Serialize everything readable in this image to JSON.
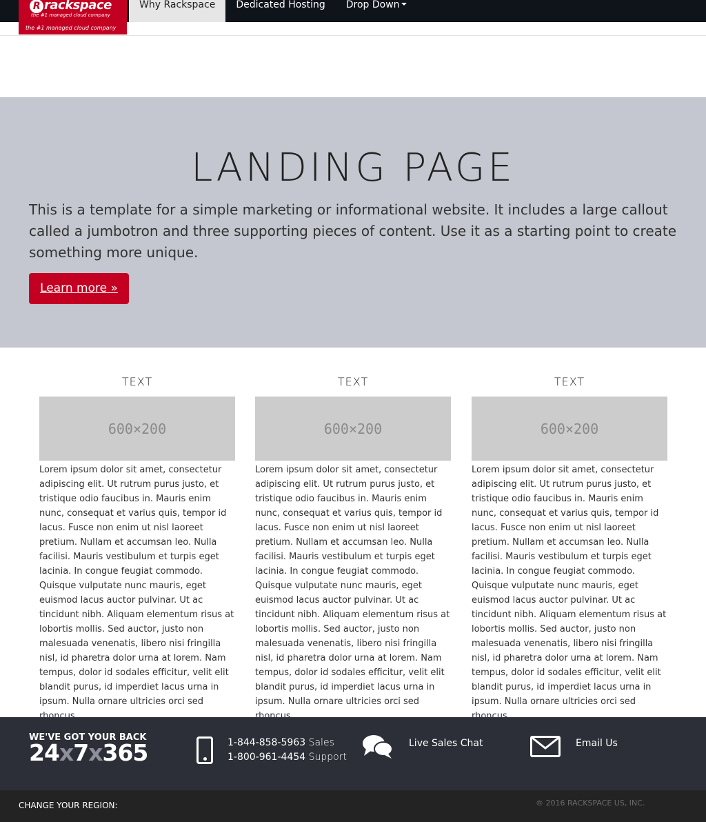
{
  "brand": {
    "name": "rackspace",
    "initial": "R",
    "tagline": "the #1 managed cloud company",
    "accent_color": "#c40022"
  },
  "nav": {
    "items": [
      {
        "label": "Why Rackspace",
        "active": true
      },
      {
        "label": "Dedicated Hosting",
        "active": false
      },
      {
        "label": "Drop Down",
        "active": false,
        "dropdown": true
      }
    ]
  },
  "jumbotron": {
    "title": "LANDING PAGE",
    "text": "This is a template for a simple marketing or informational website. It includes a large callout called a jumbotron and three supporting pieces of content. Use it as a starting point to create something more unique.",
    "button_label": "Learn more »"
  },
  "columns": [
    {
      "heading": "TEXT",
      "placeholder": "600×200",
      "body": "Lorem ipsum dolor sit amet, consectetur adipiscing elit. Ut rutrum purus justo, et tristique odio faucibus in. Mauris enim nunc, consequat et varius quis, tempor id lacus. Fusce non enim ut nisl laoreet pretium. Nullam et accumsan leo. Nulla facilisi. Mauris vestibulum et turpis eget lacinia. In congue feugiat commodo. Quisque vulputate nunc mauris, eget euismod lacus auctor pulvinar. Ut ac tincidunt nibh. Aliquam elementum risus at lobortis mollis. Sed auctor, justo non malesuada venenatis, libero nisi fringilla nisl, id pharetra dolor urna at lorem. Nam tempus, dolor id sodales efficitur, velit elit blandit purus, id imperdiet lacus urna in ipsum. Nulla ornare ultricies orci sed rhoncus."
    },
    {
      "heading": "TEXT",
      "placeholder": "600×200",
      "body": "Lorem ipsum dolor sit amet, consectetur adipiscing elit. Ut rutrum purus justo, et tristique odio faucibus in. Mauris enim nunc, consequat et varius quis, tempor id lacus. Fusce non enim ut nisl laoreet pretium. Nullam et accumsan leo. Nulla facilisi. Mauris vestibulum et turpis eget lacinia. In congue feugiat commodo. Quisque vulputate nunc mauris, eget euismod lacus auctor pulvinar. Ut ac tincidunt nibh. Aliquam elementum risus at lobortis mollis. Sed auctor, justo non malesuada venenatis, libero nisi fringilla nisl, id pharetra dolor urna at lorem. Nam tempus, dolor id sodales efficitur, velit elit blandit purus, id imperdiet lacus urna in ipsum. Nulla ornare ultricies orci sed rhoncus."
    },
    {
      "heading": "TEXT",
      "placeholder": "600×200",
      "body": "Lorem ipsum dolor sit amet, consectetur adipiscing elit. Ut rutrum purus justo, et tristique odio faucibus in. Mauris enim nunc, consequat et varius quis, tempor id lacus. Fusce non enim ut nisl laoreet pretium. Nullam et accumsan leo. Nulla facilisi. Mauris vestibulum et turpis eget lacinia. In congue feugiat commodo. Quisque vulputate nunc mauris, eget euismod lacus auctor pulvinar. Ut ac tincidunt nibh. Aliquam elementum risus at lobortis mollis. Sed auctor, justo non malesuada venenatis, libero nisi fringilla nisl, id pharetra dolor urna at lorem. Nam tempus, dolor id sodales efficitur, velit elit blandit purus, id imperdiet lacus urna in ipsum. Nulla ornare ultricies orci sed rhoncus."
    }
  ],
  "footer": {
    "back_title": "WE'VE GOT YOUR BACK",
    "hours": {
      "a": "24",
      "x1": "x",
      "b": "7",
      "x2": "x",
      "c": "365"
    },
    "phone_icon": "phone-icon",
    "sales_phone": "1-844-858-5963",
    "sales_label": "Sales",
    "support_phone": "1-800-961-4454",
    "support_label": "Support",
    "chat_icon": "chat-bubbles-icon",
    "chat_label": "Live Sales Chat",
    "mail_icon": "envelope-icon",
    "email_label": "Email Us",
    "region_label": "CHANGE YOUR REGION:",
    "copyright": "® 2016 RACKSPACE US, INC."
  }
}
